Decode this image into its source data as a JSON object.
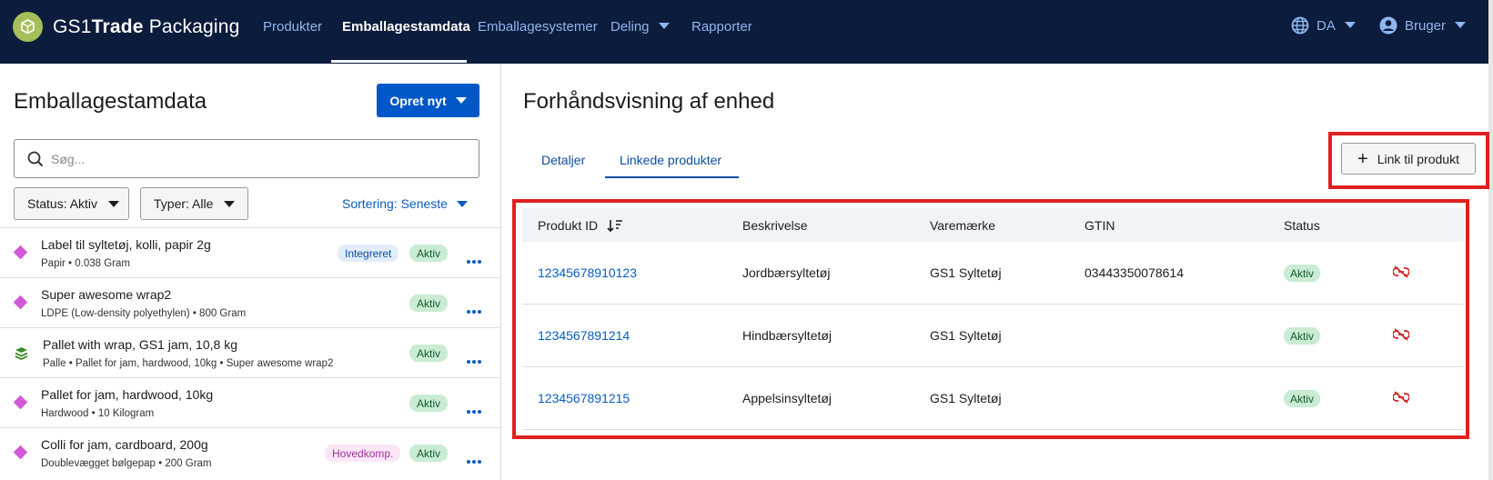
{
  "header": {
    "brand_prefix": "GS1",
    "brand_bold": "Trade",
    "brand_suffix": " Packaging",
    "nav": [
      {
        "label": "Produkter"
      },
      {
        "label": "Emballagestamdata"
      },
      {
        "label": "Emballagesystemer"
      },
      {
        "label": "Deling"
      },
      {
        "label": "Rapporter"
      }
    ],
    "language": "DA",
    "user": "Bruger",
    "icons": {
      "logo": "package-logo-icon",
      "globe": "globe-icon",
      "user": "user-avatar-icon"
    }
  },
  "left": {
    "title": "Emballagestamdata",
    "create_button": "Opret nyt",
    "search_placeholder": "Søg...",
    "filter_status": "Status: Aktiv",
    "filter_types": "Typer: Alle",
    "sort": "Sortering: Seneste",
    "items": [
      {
        "name": "Label til syltetøj, kolli, papir 2g",
        "sub": "Papir • 0.038 Gram",
        "tag": "Integreret",
        "status": "Aktiv",
        "icon": "diamond-icon"
      },
      {
        "name": "Super awesome wrap2",
        "sub": "LDPE (Low-density polyethylen) • 800 Gram",
        "tag": "",
        "status": "Aktiv",
        "icon": "diamond-icon"
      },
      {
        "name": "Pallet with wrap, GS1 jam, 10,8 kg",
        "sub": "Palle • Pallet for jam, hardwood, 10kg • Super awesome wrap2",
        "tag": "",
        "status": "Aktiv",
        "icon": "layers-icon"
      },
      {
        "name": "Pallet for jam, hardwood, 10kg",
        "sub": "Hardwood • 10 Kilogram",
        "tag": "",
        "status": "Aktiv",
        "icon": "diamond-icon"
      },
      {
        "name": "Colli for jam, cardboard, 200g",
        "sub": "Doublevægget bølgepap • 200 Gram",
        "tag": "Hovedkomp.",
        "status": "Aktiv",
        "icon": "diamond-icon"
      }
    ]
  },
  "right": {
    "title": "Forhåndsvisning af enhed",
    "tabs": [
      {
        "label": "Detaljer"
      },
      {
        "label": "Linkede produkter"
      }
    ],
    "link_button": "Link til produkt",
    "columns": [
      "Produkt ID",
      "Beskrivelse",
      "Varemærke",
      "GTIN",
      "Status"
    ],
    "rows": [
      {
        "id": "12345678910123",
        "desc": "Jordbærsyltetøj",
        "brand": "GS1 Syltetøj",
        "gtin": "03443350078614",
        "status": "Aktiv"
      },
      {
        "id": "1234567891214",
        "desc": "Hindbærsyltetøj",
        "brand": "GS1 Syltetøj",
        "gtin": "",
        "status": "Aktiv"
      },
      {
        "id": "1234567891215",
        "desc": "Appelsinsyltetøj",
        "brand": "GS1 Syltetøj",
        "gtin": "",
        "status": "Aktiv"
      }
    ]
  },
  "colors": {
    "topbar": "#0c1c3c",
    "primary": "#0057c8",
    "highlight": "#e02020",
    "aktiv_bg": "#c9ecd3",
    "unlink": "#d61f1f"
  }
}
